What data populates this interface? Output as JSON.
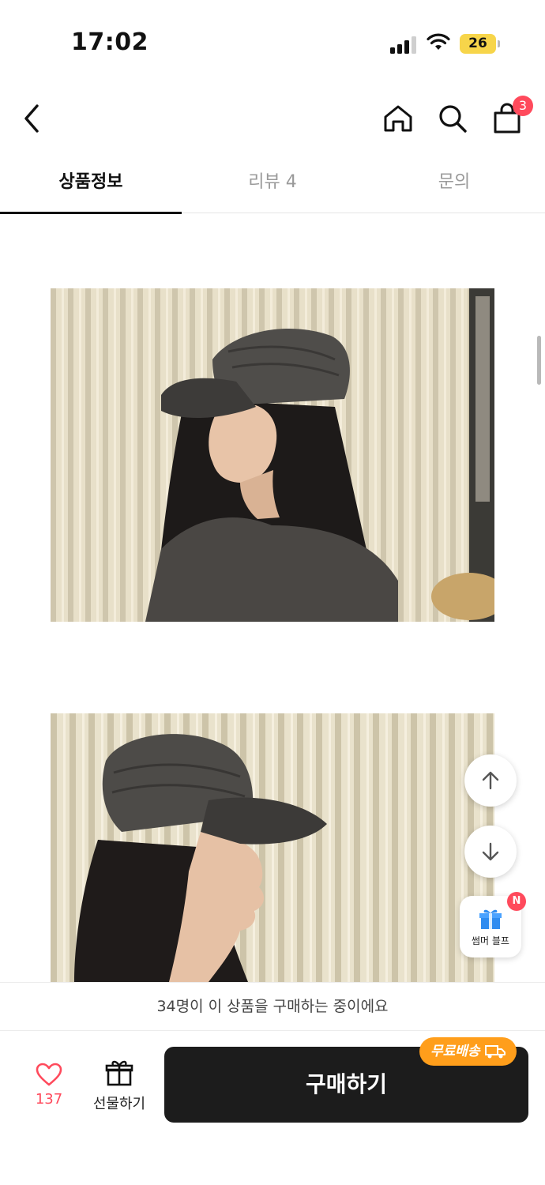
{
  "status_bar": {
    "time": "17:02",
    "battery": "26"
  },
  "header": {
    "cart_count": "3"
  },
  "tabs": [
    {
      "label": "상품정보",
      "active": true
    },
    {
      "label": "리뷰 4",
      "active": false
    },
    {
      "label": "문의",
      "active": false
    }
  ],
  "images": [
    {
      "name": "model-wearing-gray-cap-side-view"
    },
    {
      "name": "model-wearing-gray-cap-profile"
    }
  ],
  "floating": {
    "promo_label": "썸머 블프",
    "promo_badge": "N"
  },
  "notice": {
    "text": "34명이 이 상품을 구매하는 중이에요"
  },
  "bottom_bar": {
    "like_count": "137",
    "gift_label": "선물하기",
    "buy_label": "구매하기",
    "free_shipping": "무료배송"
  },
  "colors": {
    "accent": "#ff4a5c",
    "buy_button": "#1c1c1c",
    "free_shipping_badge": "#ff9e1b",
    "battery": "#f7d54a"
  }
}
